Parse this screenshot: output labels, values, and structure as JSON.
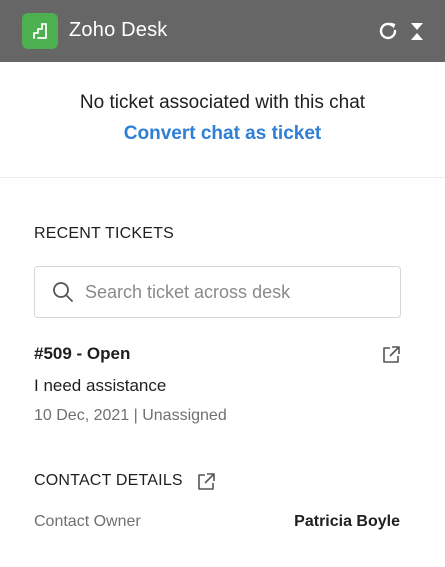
{
  "header": {
    "app_title": "Zoho Desk",
    "logo_icon": "zoho-desk-logo",
    "refresh_icon": "refresh-icon",
    "collapse_icon": "collapse-icon",
    "colors": {
      "bar": "#666666",
      "logo": "#4caf50"
    }
  },
  "banner": {
    "message": "No ticket associated with this chat",
    "link": "Convert chat as ticket",
    "link_color": "#2f7fd7"
  },
  "recent": {
    "title": "RECENT TICKETS",
    "search": {
      "placeholder": "Search ticket across desk",
      "value": ""
    },
    "tickets": [
      {
        "heading": "#509 - Open",
        "subject": "I need assistance",
        "meta": "10 Dec, 2021 | Unassigned"
      }
    ]
  },
  "contact": {
    "title": "CONTACT DETAILS",
    "owner_label": "Contact Owner",
    "owner_value": "Patricia Boyle"
  }
}
